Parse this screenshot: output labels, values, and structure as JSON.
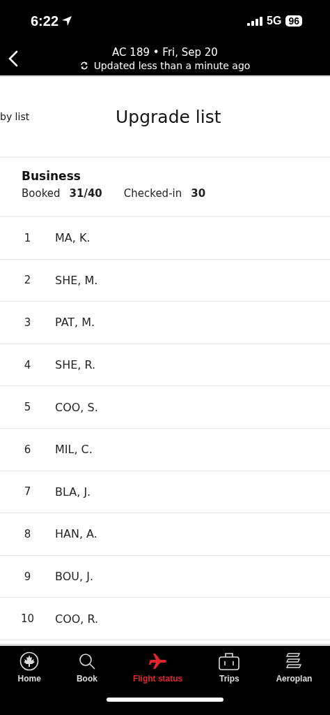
{
  "status_bar": {
    "time": "6:22",
    "network": "5G",
    "battery": "96"
  },
  "header": {
    "title": "AC 189 • Fri, Sep 20",
    "subtitle": "Updated less than a minute ago"
  },
  "tabs": [
    {
      "label": "by list",
      "selected": false
    },
    {
      "label": "Upgrade list",
      "selected": true
    }
  ],
  "cabin": {
    "name": "Business",
    "booked_label": "Booked",
    "booked": "31/40",
    "checked_in_label": "Checked-in",
    "checked_in": "30"
  },
  "passengers": [
    {
      "rank": "1",
      "name": "MA, K."
    },
    {
      "rank": "2",
      "name": "SHE, M."
    },
    {
      "rank": "3",
      "name": "PAT, M."
    },
    {
      "rank": "4",
      "name": "SHE, R."
    },
    {
      "rank": "5",
      "name": "COO, S."
    },
    {
      "rank": "6",
      "name": "MIL, C."
    },
    {
      "rank": "7",
      "name": "BLA, J."
    },
    {
      "rank": "8",
      "name": "HAN, A."
    },
    {
      "rank": "9",
      "name": "BOU, J."
    },
    {
      "rank": "10",
      "name": "COO, R."
    }
  ],
  "nav": [
    {
      "label": "Home",
      "kind": "home",
      "selected": false
    },
    {
      "label": "Book",
      "kind": "book",
      "selected": false
    },
    {
      "label": "Flight status",
      "kind": "flight",
      "selected": true
    },
    {
      "label": "Trips",
      "kind": "trips",
      "selected": false
    },
    {
      "label": "Aeroplan",
      "kind": "aeroplan",
      "selected": false
    }
  ]
}
